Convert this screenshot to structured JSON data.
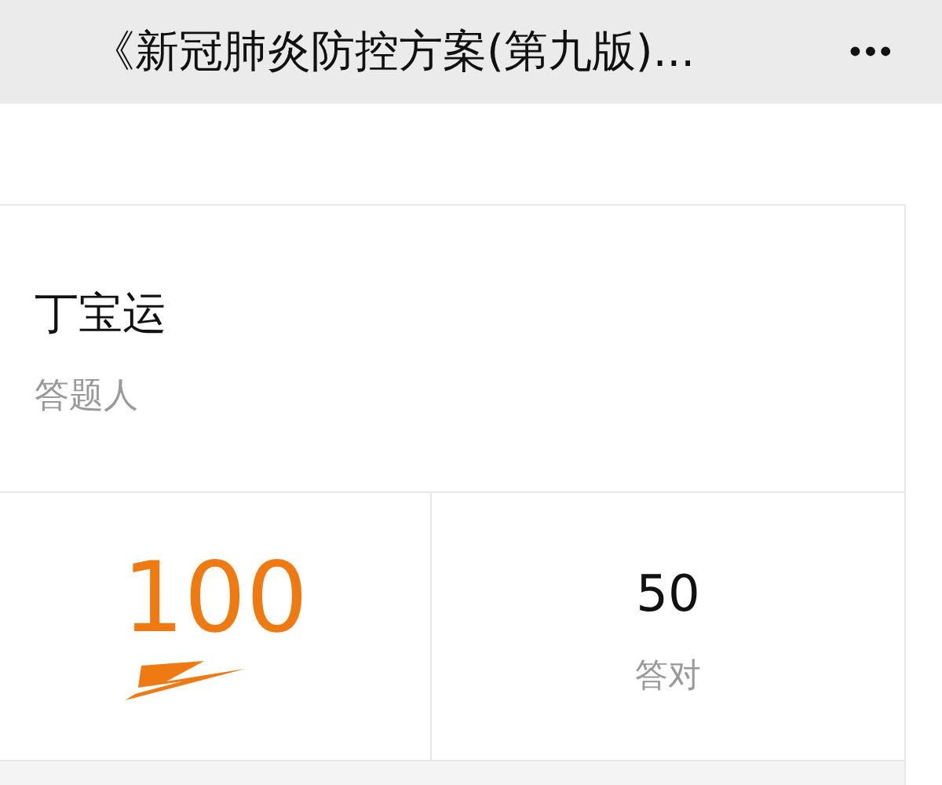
{
  "header": {
    "title": "《新冠肺炎防控方案(第九版)...",
    "more": "•••"
  },
  "answerer": {
    "name": "丁宝运",
    "label": "答题人"
  },
  "score": {
    "value": "100"
  },
  "correct": {
    "value": "50",
    "label": "答对"
  }
}
